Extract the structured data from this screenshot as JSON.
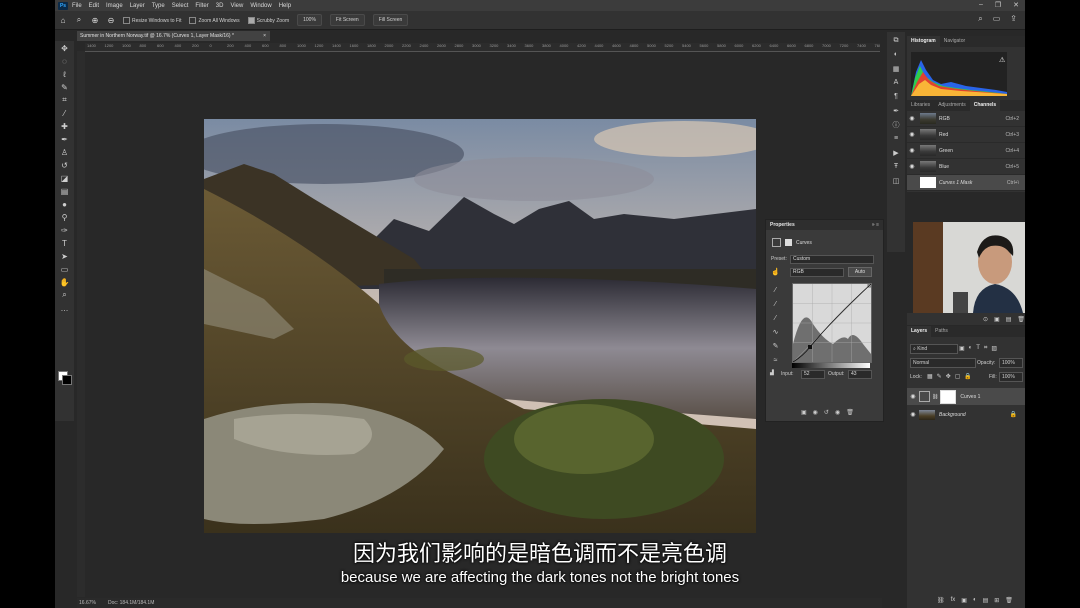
{
  "menu": {
    "app_logo": "Ps",
    "items": [
      "File",
      "Edit",
      "Image",
      "Layer",
      "Type",
      "Select",
      "Filter",
      "3D",
      "View",
      "Window",
      "Help"
    ]
  },
  "options_bar": {
    "resize_windows": "Resize Windows to Fit",
    "zoom_all_windows": "Zoom All Windows",
    "scrubby_zoom": "Scrubby Zoom",
    "zoom_percent": "100%",
    "fit_screen": "Fit Screen",
    "fill_screen": "Fill Screen"
  },
  "document": {
    "tab_title": "Summer in Northern Norway.tif @ 16.7% (Curves 1, Layer Mask/16) *",
    "ruler_ticks": [
      "1400",
      "1200",
      "1000",
      "800",
      "600",
      "400",
      "200",
      "0",
      "200",
      "400",
      "600",
      "800",
      "1000",
      "1200",
      "1400",
      "1600",
      "1800",
      "2000",
      "2200",
      "2400",
      "2600",
      "2800",
      "3000",
      "3200",
      "3400",
      "3600",
      "3800",
      "4000",
      "4200",
      "4400",
      "4600",
      "4800",
      "5000",
      "5200",
      "5400",
      "5600",
      "5800",
      "6000",
      "6200",
      "6400",
      "6600",
      "6800",
      "7000",
      "7200",
      "7400",
      "7600"
    ],
    "status_zoom": "16.67%",
    "status_doc": "Doc: 184.1M/184.1M"
  },
  "properties": {
    "title": "Properties",
    "adjustment_label": "Curves",
    "preset_label": "Preset:",
    "preset_value": "Custom",
    "channel_value": "RGB",
    "auto_label": "Auto",
    "input_label": "Input:",
    "input_value": "52",
    "output_label": "Output:",
    "output_value": "43"
  },
  "histogram_panel": {
    "tabs": [
      "Histogram",
      "Navigator"
    ],
    "warning_icon": "⚠"
  },
  "channels_panel": {
    "tabs": [
      "Libraries",
      "Adjustments",
      "Channels"
    ],
    "rows": [
      {
        "name": "RGB",
        "shortcut": "Ctrl+2"
      },
      {
        "name": "Red",
        "shortcut": "Ctrl+3"
      },
      {
        "name": "Green",
        "shortcut": "Ctrl+4"
      },
      {
        "name": "Blue",
        "shortcut": "Ctrl+5"
      },
      {
        "name": "Curves 1 Mask",
        "shortcut": "Ctrl+\\"
      }
    ]
  },
  "layers_panel": {
    "tabs": [
      "Layers",
      "Paths"
    ],
    "filter_kind": "Kind",
    "blend_mode": "Normal",
    "opacity_label": "Opacity:",
    "opacity_value": "100%",
    "lock_label": "Lock:",
    "fill_label": "Fill:",
    "fill_value": "100%",
    "layers": [
      {
        "name": "Curves 1"
      },
      {
        "name": "Background"
      }
    ]
  },
  "subtitles": {
    "zh": "因为我们影响的是暗色调而不是亮色调",
    "en": "because we are affecting the dark tones not the bright tones"
  },
  "colors": {
    "ui_dark": "#282828",
    "panel": "#323232",
    "accent_ps": "#31a8ff"
  }
}
